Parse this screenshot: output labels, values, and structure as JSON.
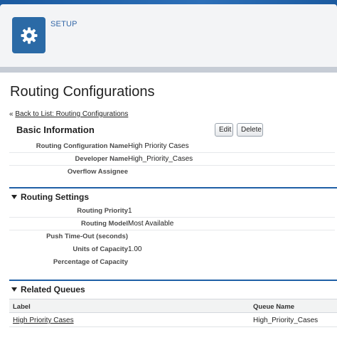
{
  "header": {
    "setup_label": "SETUP",
    "icon": "gear-icon",
    "tile_color": "#2b6aa6"
  },
  "page": {
    "title": "Routing Configurations",
    "back_prefix": "« ",
    "back_link": "Back to List: Routing Configurations"
  },
  "basic_information": {
    "title": "Basic Information",
    "edit_label": "Edit",
    "delete_label": "Delete",
    "fields": [
      {
        "label": "Routing Configuration Name",
        "value": "High Priority Cases"
      },
      {
        "label": "Developer Name",
        "value": "High_Priority_Cases"
      },
      {
        "label": "Overflow Assignee",
        "value": ""
      }
    ]
  },
  "routing_settings": {
    "title": "Routing Settings",
    "fields": [
      {
        "label": "Routing Priority",
        "value": "1"
      },
      {
        "label": "Routing Model",
        "value": "Most Available"
      },
      {
        "label": "Push Time-Out (seconds)",
        "value": ""
      },
      {
        "label": "Units of Capacity",
        "value": "1.00"
      },
      {
        "label": "Percentage of Capacity",
        "value": ""
      }
    ]
  },
  "related_queues": {
    "title": "Related Queues",
    "columns": [
      "Label",
      "Queue Name"
    ],
    "rows": [
      {
        "label": "High Priority Cases",
        "queue_name": "High_Priority_Cases"
      }
    ]
  },
  "colors": {
    "accent": "#1f5fa6",
    "header_bg": "#f3f4f6"
  }
}
